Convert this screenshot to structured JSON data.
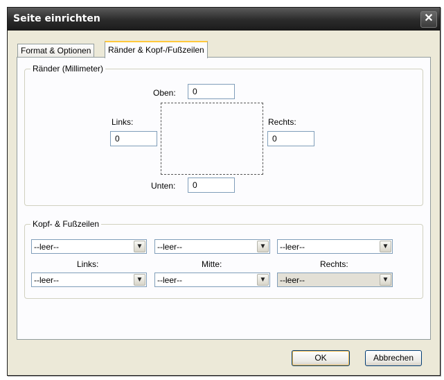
{
  "window": {
    "title": "Seite einrichten",
    "close_glyph": "✕"
  },
  "tabs": [
    {
      "label": "Format & Optionen",
      "active": false
    },
    {
      "label": "Ränder & Kopf-/Fußzeilen",
      "active": true
    }
  ],
  "margins": {
    "group_title": "Ränder (Millimeter)",
    "top_label": "Oben:",
    "top_value": "0",
    "left_label": "Links:",
    "left_value": "0",
    "right_label": "Rechts:",
    "right_value": "0",
    "bottom_label": "Unten:",
    "bottom_value": "0"
  },
  "headers_footers": {
    "group_title": "Kopf- & Fußzeilen",
    "labels": {
      "left": "Links:",
      "center": "Mitte:",
      "right": "Rechts:"
    },
    "header": {
      "left": "--leer--",
      "center": "--leer--",
      "right": "--leer--"
    },
    "footer": {
      "left": "--leer--",
      "center": "--leer--",
      "right": "--leer--"
    },
    "dropdown_icon": "chevron-down-icon"
  },
  "buttons": {
    "ok": "OK",
    "cancel": "Abbrechen"
  }
}
